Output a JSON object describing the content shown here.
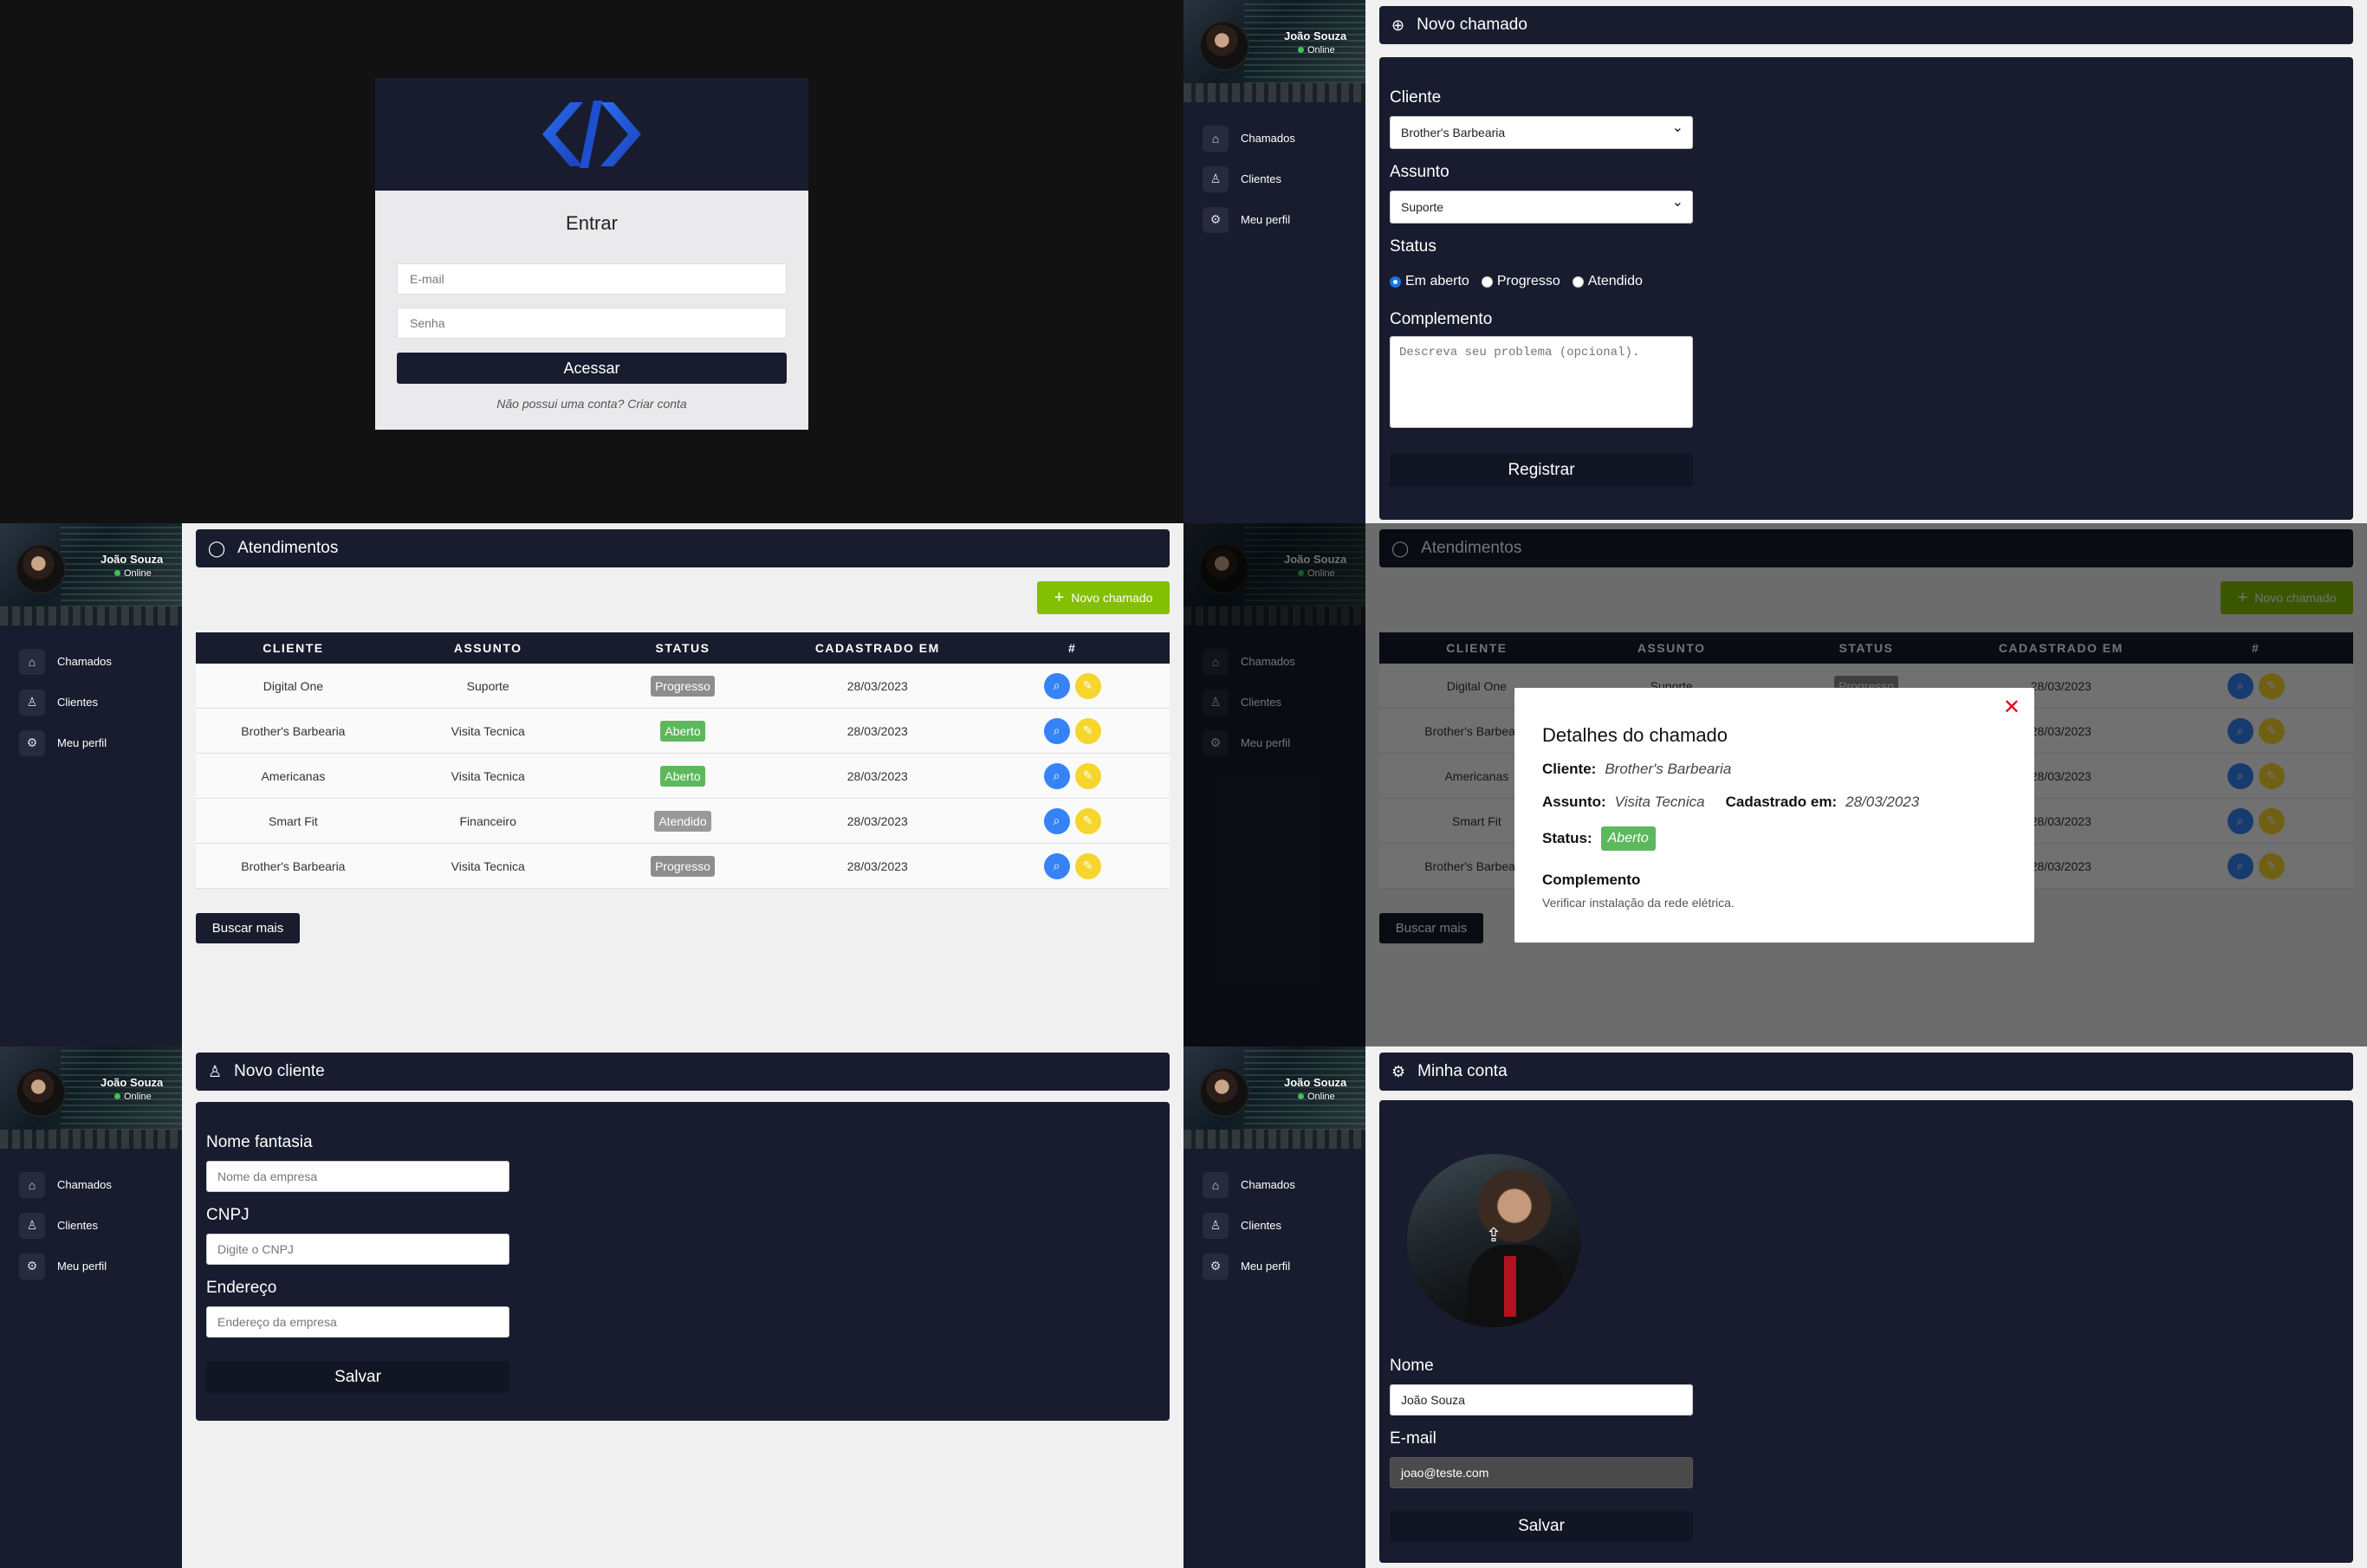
{
  "user": {
    "name": "João Souza",
    "status": "Online"
  },
  "sidebar": {
    "items": [
      {
        "icon": "home-icon",
        "label": "Chamados"
      },
      {
        "icon": "user-icon",
        "label": "Clientes"
      },
      {
        "icon": "gear-icon",
        "label": "Meu perfil"
      }
    ]
  },
  "login": {
    "title": "Entrar",
    "email_placeholder": "E-mail",
    "password_placeholder": "Senha",
    "submit": "Acessar",
    "register_link": "Não possui uma conta? Criar conta"
  },
  "new_ticket": {
    "title": "Novo chamado",
    "client_label": "Cliente",
    "client_value": "Brother's Barbearia",
    "subject_label": "Assunto",
    "subject_value": "Suporte",
    "status_label": "Status",
    "status_options": [
      "Em aberto",
      "Progresso",
      "Atendido"
    ],
    "status_selected": "Em aberto",
    "complement_label": "Complemento",
    "complement_placeholder": "Descreva seu problema (opcional).",
    "submit": "Registrar"
  },
  "tickets": {
    "title": "Atendimentos",
    "new_button": "Novo chamado",
    "more_button": "Buscar mais",
    "columns": [
      "CLIENTE",
      "ASSUNTO",
      "STATUS",
      "CADASTRADO EM",
      "#"
    ],
    "rows": [
      {
        "client": "Digital One",
        "subject": "Suporte",
        "status": "Progresso",
        "date": "28/03/2023"
      },
      {
        "client": "Brother's Barbearia",
        "subject": "Visita Tecnica",
        "status": "Aberto",
        "date": "28/03/2023"
      },
      {
        "client": "Americanas",
        "subject": "Visita Tecnica",
        "status": "Aberto",
        "date": "28/03/2023"
      },
      {
        "client": "Smart Fit",
        "subject": "Financeiro",
        "status": "Atendido",
        "date": "28/03/2023"
      },
      {
        "client": "Brother's Barbearia",
        "subject": "Visita Tecnica",
        "status": "Progresso",
        "date": "28/03/2023"
      }
    ],
    "status_colors": {
      "Progresso": "#8d8d8d",
      "Aberto": "#5cb85c",
      "Atendido": "#999999"
    }
  },
  "details": {
    "title": "Detalhes do chamado",
    "client_label": "Cliente:",
    "client_value": "Brother's Barbearia",
    "subject_label": "Assunto:",
    "subject_value": "Visita Tecnica",
    "created_label": "Cadastrado em:",
    "created_value": "28/03/2023",
    "status_label": "Status:",
    "status_value": "Aberto",
    "complement_label": "Complemento",
    "complement_value": "Verificar instalação da rede elétrica."
  },
  "new_client": {
    "title": "Novo cliente",
    "name_label": "Nome fantasia",
    "name_placeholder": "Nome da empresa",
    "cnpj_label": "CNPJ",
    "cnpj_placeholder": "Digite o CNPJ",
    "address_label": "Endereço",
    "address_placeholder": "Endereço da empresa",
    "submit": "Salvar"
  },
  "profile": {
    "title": "Minha conta",
    "name_label": "Nome",
    "name_value": "João Souza",
    "email_label": "E-mail",
    "email_value": "joao@teste.com",
    "submit": "Salvar"
  },
  "colors": {
    "dark": "#181c2e",
    "accent_green": "#83bf02",
    "search_blue": "#3583f6",
    "edit_yellow": "#f6d52c",
    "danger": "#e3001b"
  }
}
